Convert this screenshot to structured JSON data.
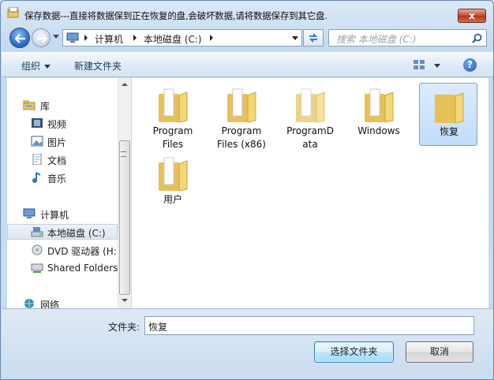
{
  "window": {
    "title": "保存数据---直接将数据保到正在恢复的盘,会破坏数据,请将数据保存到其它盘.",
    "close_label": "x"
  },
  "address": {
    "breadcrumbs": [
      "计算机",
      "本地磁盘 (C:)"
    ],
    "search_placeholder": "搜索 本地磁盘 (C:)"
  },
  "toolbar": {
    "organize_label": "组织",
    "new_folder_label": "新建文件夹",
    "help_label": "?"
  },
  "nav": {
    "items": [
      {
        "label": "库",
        "icon": "library-icon"
      },
      {
        "label": "视频",
        "icon": "video-icon"
      },
      {
        "label": "图片",
        "icon": "picture-icon"
      },
      {
        "label": "文档",
        "icon": "document-icon"
      },
      {
        "label": "音乐",
        "icon": "music-icon"
      },
      {
        "label": "计算机",
        "icon": "computer-icon"
      },
      {
        "label": "本地磁盘 (C:)",
        "icon": "local-disk-icon",
        "selected": true
      },
      {
        "label": "DVD 驱动器 (H:)",
        "icon": "dvd-drive-icon"
      },
      {
        "label": "Shared Folders",
        "icon": "shared-folders-icon"
      },
      {
        "label": "网络",
        "icon": "network-icon"
      }
    ]
  },
  "folders": [
    {
      "line1": "Program",
      "line2": "Files"
    },
    {
      "line1": "Program",
      "line2": "Files (x86)"
    },
    {
      "line1": "ProgramD",
      "line2": "ata"
    },
    {
      "line1": "Windows",
      "line2": ""
    },
    {
      "line1": "恢复",
      "line2": "",
      "selected": true
    },
    {
      "line1": "用户",
      "line2": ""
    }
  ],
  "footer": {
    "folder_label": "文件夹:",
    "folder_value": "恢复",
    "select_button": "选择文件夹",
    "cancel_button": "取消"
  },
  "colors": {
    "selection_fill": "#c1dcfa",
    "folder_yellow": "#f3d774",
    "primary_button": "#bee6fd"
  }
}
